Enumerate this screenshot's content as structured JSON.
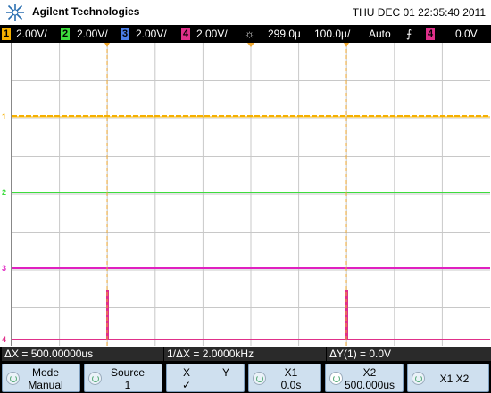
{
  "header": {
    "brand": "Agilent Technologies",
    "datetime": "THU DEC 01 22:35:40 2011"
  },
  "status": {
    "ch1_num": "1",
    "ch1_scale": "2.00V/",
    "ch2_num": "2",
    "ch2_scale": "2.00V/",
    "ch3_num": "3",
    "ch3_scale": "2.00V/",
    "ch4_num": "4",
    "ch4_scale": "2.00V/",
    "trigger_icon": "☼",
    "delay": "299.0µ",
    "timebase": "100.0µ/",
    "mode": "Auto",
    "edge_icon": "⨍",
    "trig_source": "4",
    "trig_level": "0.0V"
  },
  "markers": {
    "ch1": "1",
    "ch2": "2",
    "ch3": "3",
    "ch4": "4"
  },
  "measurements": {
    "delta_x": "ΔX = 500.00000us",
    "inv_delta_x": "1/ΔX = 2.0000kHz",
    "delta_y": "ΔY(1) = 0.0V"
  },
  "softkeys": {
    "mode_title": "Mode",
    "mode_value": "Manual",
    "source_title": "Source",
    "source_value": "1",
    "x_label": "X",
    "y_label": "Y",
    "xy_check": "✓",
    "x1_title": "X1",
    "x1_value": "0.0s",
    "x2_title": "X2",
    "x2_value": "500.000us",
    "x1x2_label": "X1 X2"
  },
  "colors": {
    "ch1": "#f5b000",
    "ch2": "#3ddc3d",
    "ch3": "#e020c0",
    "ch4": "#e0308a",
    "grid": "#c8c8c8",
    "cursor": "#f0a830"
  }
}
